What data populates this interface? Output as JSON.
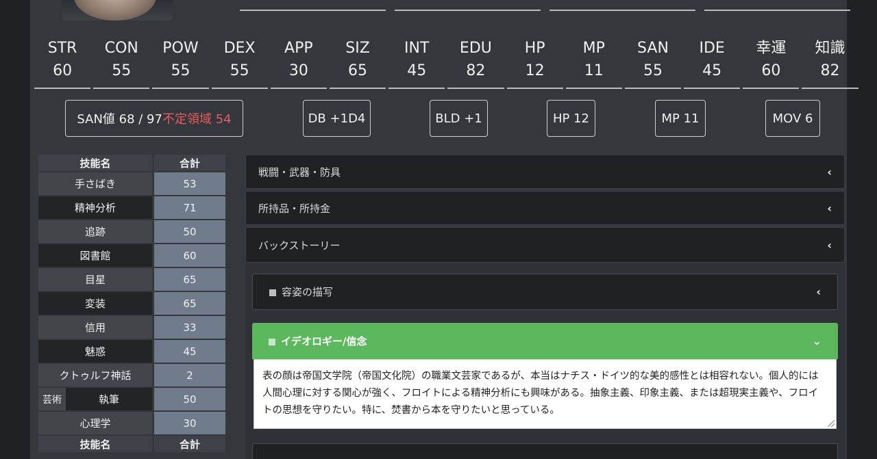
{
  "top_fields": [
    "",
    "",
    "",
    ""
  ],
  "stats": [
    {
      "label": "STR",
      "value": "60"
    },
    {
      "label": "CON",
      "value": "55"
    },
    {
      "label": "POW",
      "value": "55"
    },
    {
      "label": "DEX",
      "value": "55"
    },
    {
      "label": "APP",
      "value": "30"
    },
    {
      "label": "SIZ",
      "value": "65"
    },
    {
      "label": "INT",
      "value": "45"
    },
    {
      "label": "EDU",
      "value": "82"
    },
    {
      "label": "HP",
      "value": "12"
    },
    {
      "label": "MP",
      "value": "11"
    },
    {
      "label": "SAN",
      "value": "55"
    },
    {
      "label": "IDE",
      "value": "45"
    },
    {
      "label": "幸運",
      "value": "60"
    },
    {
      "label": "知識",
      "value": "82"
    }
  ],
  "derived": {
    "san_main": "SAN値 68 / 97",
    "san_red": "不定領域 54",
    "db": "DB +1D4",
    "bld": "BLD +1",
    "hp": "HP 12",
    "mp": "MP 11",
    "mov": "MOV 6"
  },
  "skills": {
    "header_name": "技能名",
    "header_total": "合計",
    "rows": [
      {
        "name": "手さばき",
        "total": "53"
      },
      {
        "name": "精神分析",
        "total": "71"
      },
      {
        "name": "追跡",
        "total": "50"
      },
      {
        "name": "図書館",
        "total": "60"
      },
      {
        "name": "目星",
        "total": "65"
      },
      {
        "name": "変装",
        "total": "65"
      },
      {
        "name": "信用",
        "total": "33"
      },
      {
        "name": "魅惑",
        "total": "45"
      },
      {
        "name": "クトゥルフ神話",
        "total": "2"
      },
      {
        "name": "芸術",
        "sub": "執筆",
        "total": "50"
      },
      {
        "name": "心理学",
        "total": "30"
      }
    ],
    "footer_name": "技能名",
    "footer_total": "合計"
  },
  "accordions": [
    {
      "label": "戦闘・武器・防具"
    },
    {
      "label": "所持品・所持金"
    },
    {
      "label": "バックストーリー"
    }
  ],
  "backstory": {
    "appearance_label": "容姿の描写",
    "ideology_label": "イデオロギー/信念",
    "ideology_text": "表の顔は帝国文学院（帝国文化院）の職業文芸家であるが、本当はナチス・ドイツ的な美的感性とは相容れない。個人的には人間心理に対する関心が強く、フロイトによる精神分析にも興味がある。抽象主義、印象主義、または超現実主義や、フロイトの思想を守りたい。特に、焚書から本を守りたいと思っている。"
  },
  "icons": {
    "collapsed": "chevron-left-icon",
    "expanded": "chevron-down-icon"
  },
  "colors": {
    "accent_green": "#5cb85c",
    "warn_red": "#e85c5c"
  }
}
